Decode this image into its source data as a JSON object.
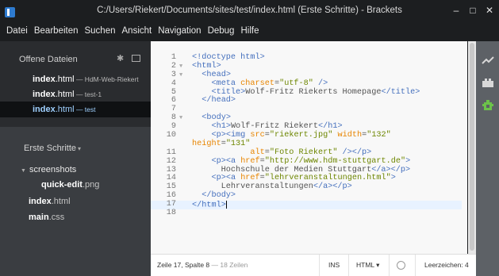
{
  "window": {
    "title": "C:/Users/Riekert/Documents/sites/test/index.html (Erste Schritte) - Brackets",
    "minimize_glyph": "–",
    "maximize_glyph": "□",
    "close_glyph": "✕"
  },
  "menu": [
    "Datei",
    "Bearbeiten",
    "Suchen",
    "Ansicht",
    "Navigation",
    "Debug",
    "Hilfe"
  ],
  "working_set": {
    "header": "Offene Dateien",
    "files": [
      {
        "name": "index",
        "ext": ".html",
        "dir": " — HdM-Web-Riekert",
        "selected": false
      },
      {
        "name": "index",
        "ext": ".html",
        "dir": " — test-1",
        "selected": false
      },
      {
        "name": "index",
        "ext": ".html",
        "dir": " — test",
        "selected": true
      }
    ]
  },
  "project": {
    "title": "Erste Schritte",
    "caret": "▾",
    "tree": [
      {
        "folder": "screenshots"
      },
      {
        "name": "quick-edit",
        "ext": ".png"
      },
      {
        "name": "index",
        "ext": ".html"
      },
      {
        "name": "main",
        "ext": ".css"
      }
    ]
  },
  "editor": {
    "lines": [
      {
        "n": "1",
        "code": "<!doctype html>"
      },
      {
        "n": "2",
        "code": "<html>"
      },
      {
        "n": "3",
        "code": "  <head>"
      },
      {
        "n": "4",
        "code": "    <meta charset=\"utf-8\" />"
      },
      {
        "n": "5",
        "code": "    <title>Wolf-Fritz Riekerts Homepage</title>"
      },
      {
        "n": "6",
        "code": "  </head>"
      },
      {
        "n": "7",
        "code": ""
      },
      {
        "n": "8",
        "code": "  <body>"
      },
      {
        "n": "9",
        "code": "    <h1>Wolf-Fritz Riekert</h1>"
      },
      {
        "n": "10",
        "code": "    <p><img src=\"riekert.jpg\" width=\"132\""
      },
      {
        "n": "",
        "code": "height=\"131\""
      },
      {
        "n": "11",
        "code": "            alt=\"Foto Riekert\" /></p>"
      },
      {
        "n": "12",
        "code": "    <p><a href=\"http://www.hdm-stuttgart.de\">"
      },
      {
        "n": "13",
        "code": "      Hochschule der Medien Stuttgart</a></p>"
      },
      {
        "n": "14",
        "code": "    <p><a href=\"lehrveranstaltungen.html\">"
      },
      {
        "n": "15",
        "code": "      Lehrveranstaltungen</a></p>"
      },
      {
        "n": "16",
        "code": "  </body>"
      },
      {
        "n": "17",
        "code": "</html>"
      },
      {
        "n": "18",
        "code": ""
      }
    ]
  },
  "statusbar": {
    "position": "Zeile 17, Spalte 8",
    "line_count": " — 18 Zeilen",
    "mode": "INS",
    "language": "HTML ▾",
    "indent": "Leerzeichen: 4"
  },
  "right_toolbar": {
    "icons": [
      "live-preview-icon",
      "extension-manager-icon",
      "extension-icon"
    ]
  }
}
